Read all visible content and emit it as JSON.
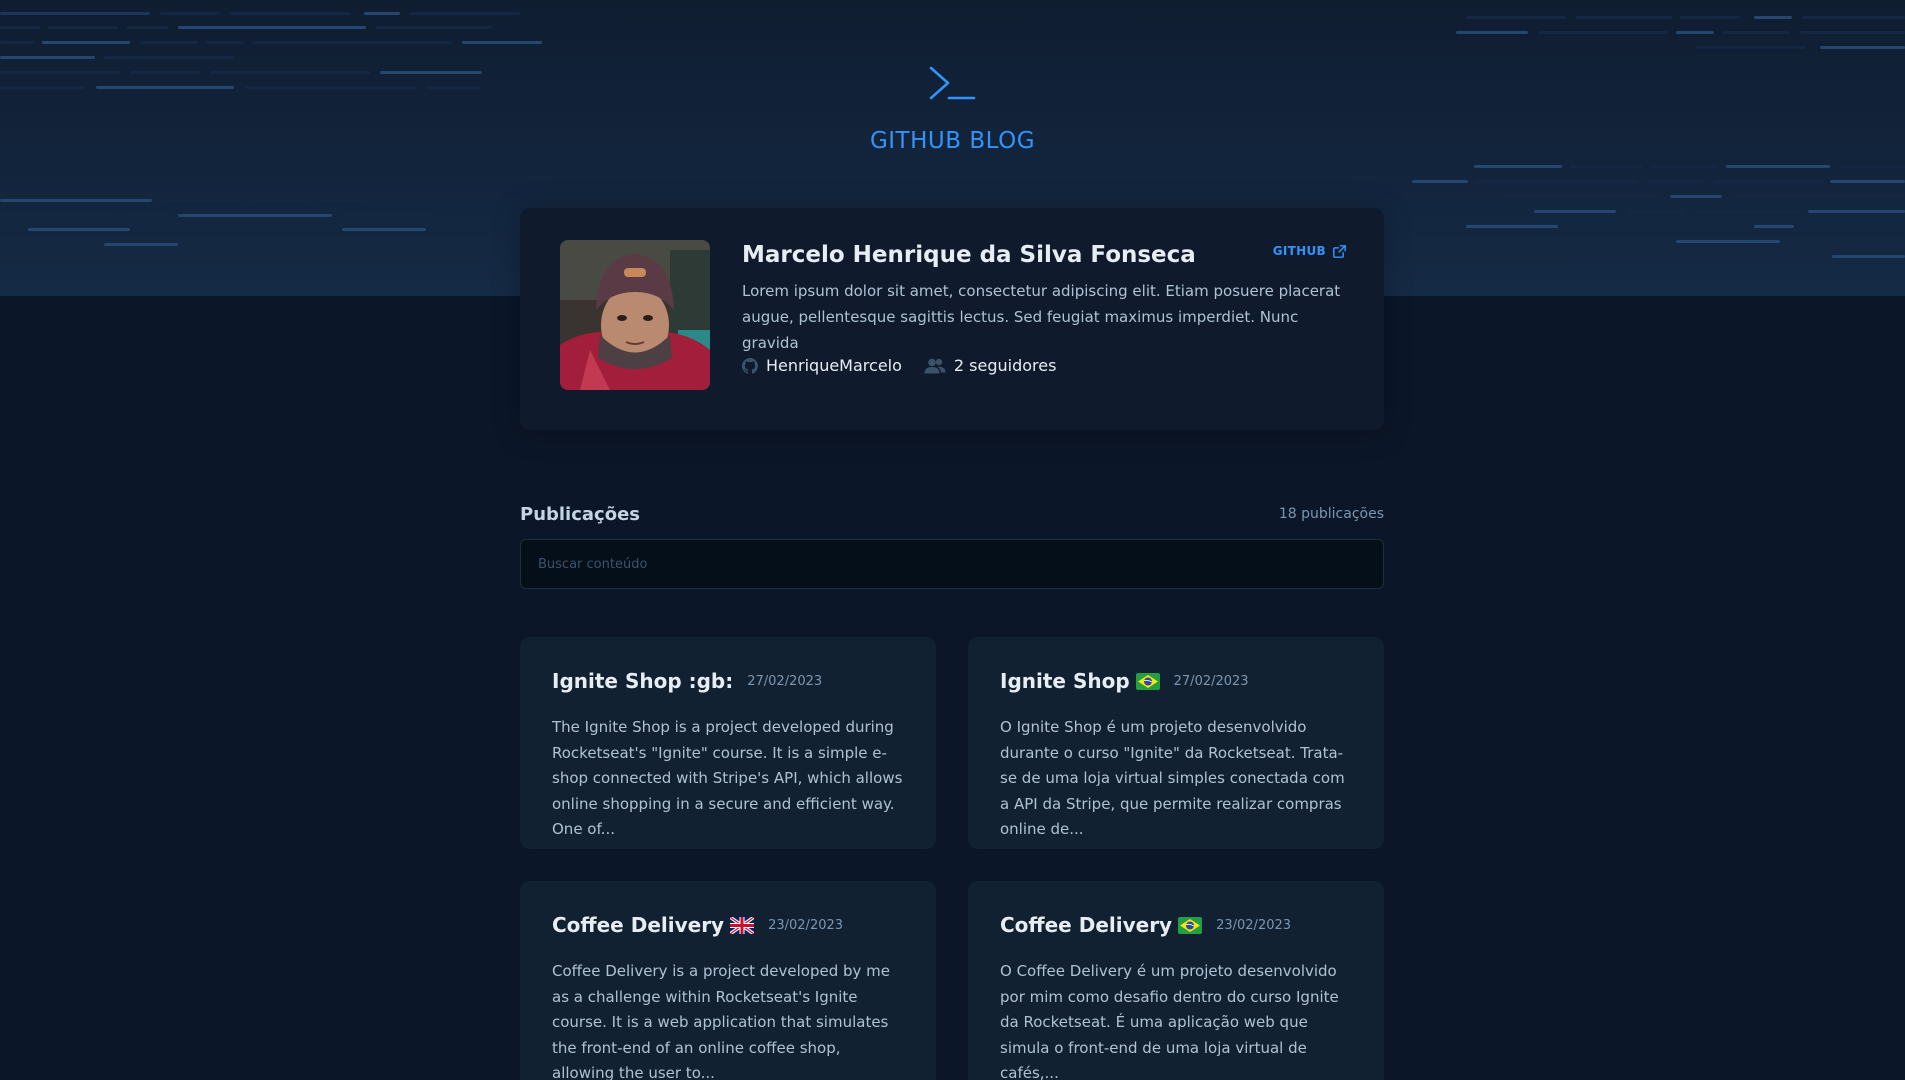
{
  "header": {
    "brand": "GITHUB BLOG"
  },
  "profile": {
    "name": "Marcelo Henrique da Silva Fonseca",
    "github_link": "GITHUB",
    "bio": "Lorem ipsum dolor sit amet, consectetur adipiscing elit. Etiam posuere placerat augue, pellentesque sagittis lectus. Sed feugiat maximus imperdiet. Nunc gravida",
    "username": "HenriqueMarcelo",
    "followers": "2 seguidores"
  },
  "publications": {
    "title": "Publicações",
    "count": "18 publicações",
    "search_placeholder": "Buscar conteúdo"
  },
  "posts": [
    {
      "title": "Ignite Shop :gb:",
      "date": "27/02/2023",
      "excerpt": "The Ignite Shop is a project developed during Rocketseat's \"Ignite\" course. It is a simple e-shop connected with Stripe's API, which allows online shopping in a secure and efficient way. One of...",
      "flag": "none"
    },
    {
      "title": "Ignite Shop",
      "date": "27/02/2023",
      "excerpt": "O Ignite Shop é um projeto desenvolvido durante o curso \"Ignite\" da Rocketseat. Trata-se de uma loja virtual simples conectada com a API da Stripe, que permite realizar compras online de...",
      "flag": "brazil-flag-icon"
    },
    {
      "title": "Coffee Delivery",
      "date": "23/02/2023",
      "excerpt": "Coffee Delivery is a project developed by me as a challenge within Rocketseat's Ignite course. It is a web application that simulates the front-end of an online coffee shop, allowing the user to...",
      "flag": "uk-flag-icon"
    },
    {
      "title": "Coffee Delivery",
      "date": "23/02/2023",
      "excerpt": "O Coffee Delivery é um projeto desenvolvido por mim como desafio dentro do curso Ignite da Rocketseat. É uma aplicação web que simula o front-end de uma loja virtual de cafés,...",
      "flag": "brazil-flag-icon"
    }
  ],
  "colors": {
    "background": "#0b1628",
    "profile_card": "#0f1b2d",
    "post_card": "#112131",
    "accent_blue": "#3294f8",
    "title_text": "#e7edf4",
    "body_text": "#afc2d4",
    "muted_text": "#7b96b2"
  }
}
